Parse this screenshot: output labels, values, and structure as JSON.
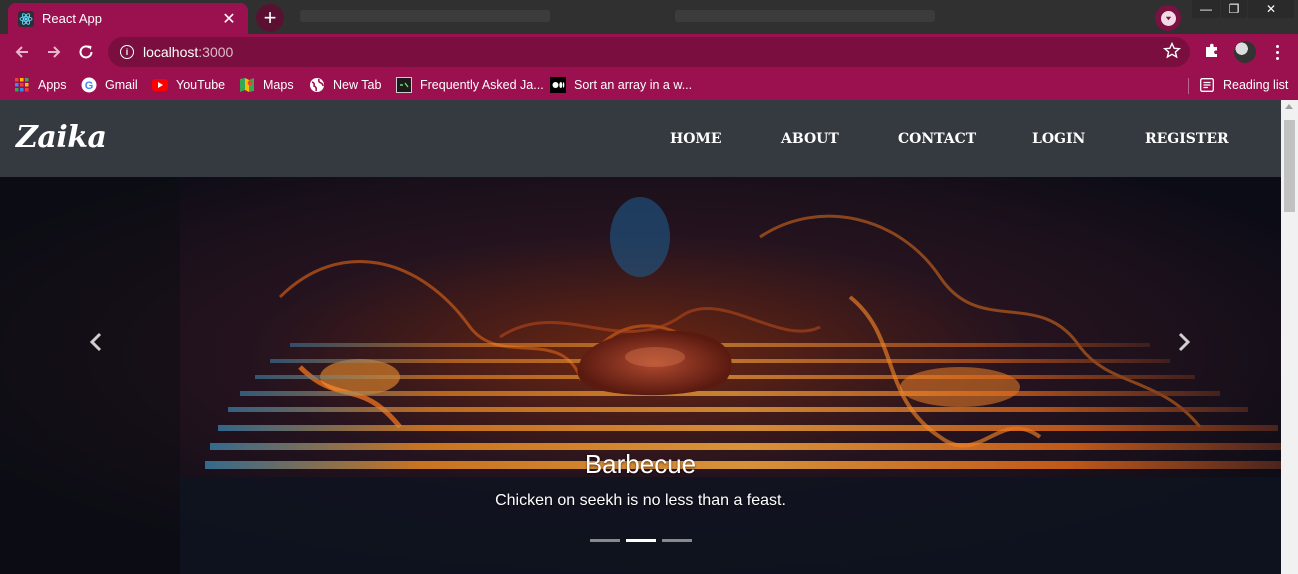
{
  "browser": {
    "tab": {
      "title": "React App",
      "icon": "react-icon"
    },
    "window_controls": {
      "minimize": "—",
      "maximize": "❐",
      "close": "✕"
    },
    "address": {
      "host": "localhost",
      "port": ":3000"
    },
    "bookmarks": [
      {
        "label": "Apps",
        "icon": "apps-grid-icon"
      },
      {
        "label": "Gmail",
        "icon": "google-icon"
      },
      {
        "label": "YouTube",
        "icon": "youtube-icon"
      },
      {
        "label": "Maps",
        "icon": "maps-icon"
      },
      {
        "label": "New Tab",
        "icon": "globe-icon"
      },
      {
        "label": "Frequently Asked Ja...",
        "icon": "site-icon"
      },
      {
        "label": "Sort an array in a w...",
        "icon": "medium-icon"
      }
    ],
    "reading_list": "Reading list",
    "theme_color": "#9b1150"
  },
  "site": {
    "brand": "Zaika",
    "nav": [
      "HOME",
      "ABOUT",
      "CONTACT",
      "LOGIN",
      "REGISTER"
    ],
    "navbar_color": "#343a40"
  },
  "carousel": {
    "caption_title": "Barbecue",
    "caption_text": "Chicken on seekh is no less than a feast.",
    "slide_count": 3,
    "active_index": 1
  }
}
